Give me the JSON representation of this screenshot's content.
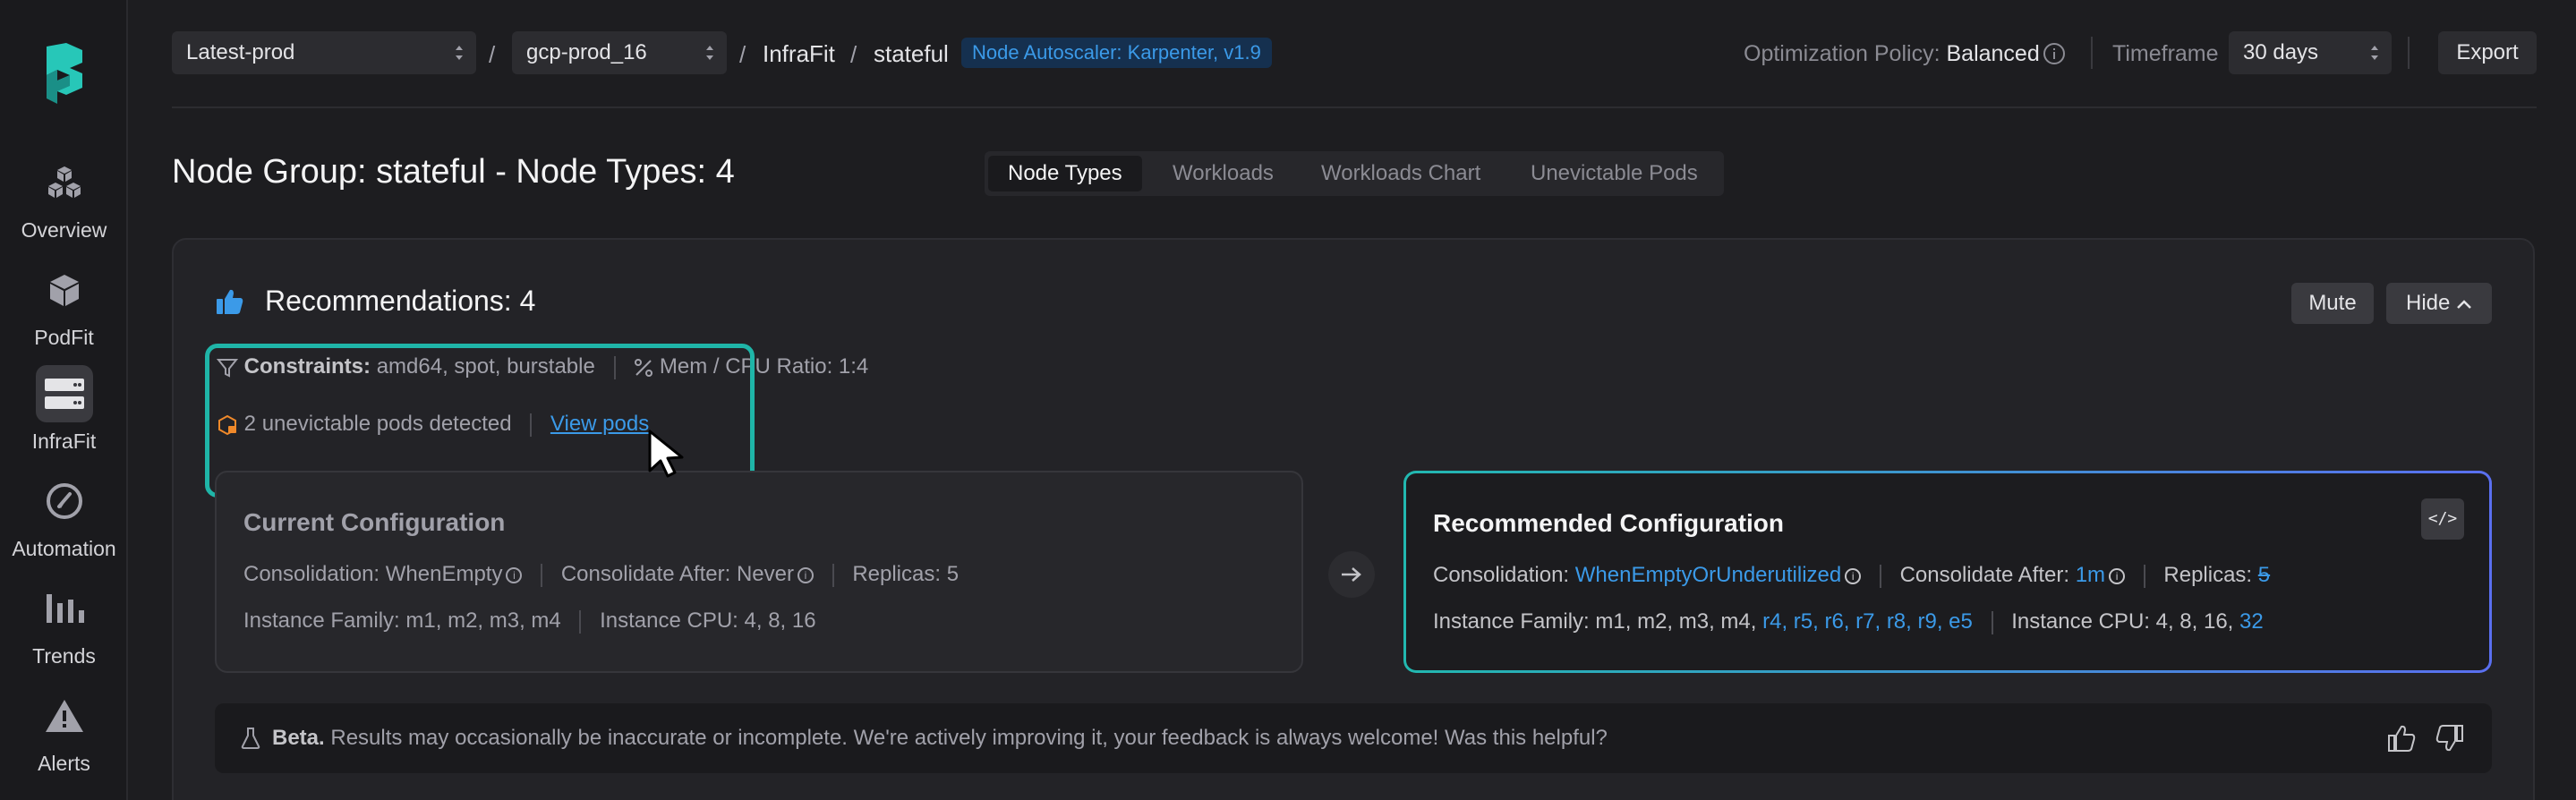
{
  "sidebar": {
    "items": [
      {
        "label": "Overview",
        "icon": "cubes-icon"
      },
      {
        "label": "PodFit",
        "icon": "cube-icon"
      },
      {
        "label": "InfraFit",
        "icon": "server-icon",
        "active": true
      },
      {
        "label": "Automation",
        "icon": "compass-icon"
      },
      {
        "label": "Trends",
        "icon": "bar-chart-icon"
      },
      {
        "label": "Alerts",
        "icon": "warning-icon"
      }
    ]
  },
  "topbar": {
    "cluster_select": "Latest-prod",
    "project_select": "gcp-prod_16",
    "sep": "/",
    "crumb_infrafit": "InfraFit",
    "crumb_stateful": "stateful",
    "autoscaler_tag": "Node Autoscaler: Karpenter, v1.9",
    "policy_label": "Optimization Policy:",
    "policy_value": "Balanced",
    "timeframe_label": "Timeframe",
    "timeframe_value": "30 days",
    "export_label": "Export"
  },
  "page": {
    "title": "Node Group: stateful - Node Types: 4",
    "tabs": [
      "Node Types",
      "Workloads",
      "Workloads Chart",
      "Unevictable Pods"
    ],
    "active_tab": "Node Types"
  },
  "recommendations": {
    "title": "Recommendations: 4",
    "mute_label": "Mute",
    "hide_label": "Hide",
    "constraints_label": "Constraints:",
    "constraints_value": "amd64, spot, burstable",
    "ratio_text": "Mem / CPU Ratio: 1:4",
    "unevictable_text": "2 unevictable pods detected",
    "view_pods_link": "View pods"
  },
  "current_config": {
    "title": "Current Configuration",
    "consolidation": "Consolidation: WhenEmpty",
    "consolidate_after": "Consolidate After: Never",
    "replicas": "Replicas: 5",
    "instance_family": "Instance Family: m1, m2, m3, m4",
    "instance_cpu": "Instance CPU: 4, 8, 16"
  },
  "recommended_config": {
    "title": "Recommended Configuration",
    "consolidation_label": "Consolidation:",
    "consolidation_value": "WhenEmptyOrUnderutilized",
    "consolidate_after_label": "Consolidate After:",
    "consolidate_after_value": "1m",
    "replicas_label": "Replicas:",
    "replicas_value": "5",
    "instance_family_label": "Instance Family: m1, m2, m3, m4,",
    "instance_family_new": "r4, r5, r6, r7, r8, r9, e5",
    "instance_cpu_label": "Instance CPU: 4, 8, 16,",
    "instance_cpu_new": "32",
    "code_label": "</>"
  },
  "beta": {
    "label": "Beta.",
    "text": "Results may occasionally be inaccurate or incomplete. We're actively improving it, your feedback is always welcome! Was this helpful?"
  },
  "colors": {
    "accent_blue": "#3b9ae8",
    "highlight_teal": "#1fb5a8",
    "warning_orange": "#f0892a"
  }
}
